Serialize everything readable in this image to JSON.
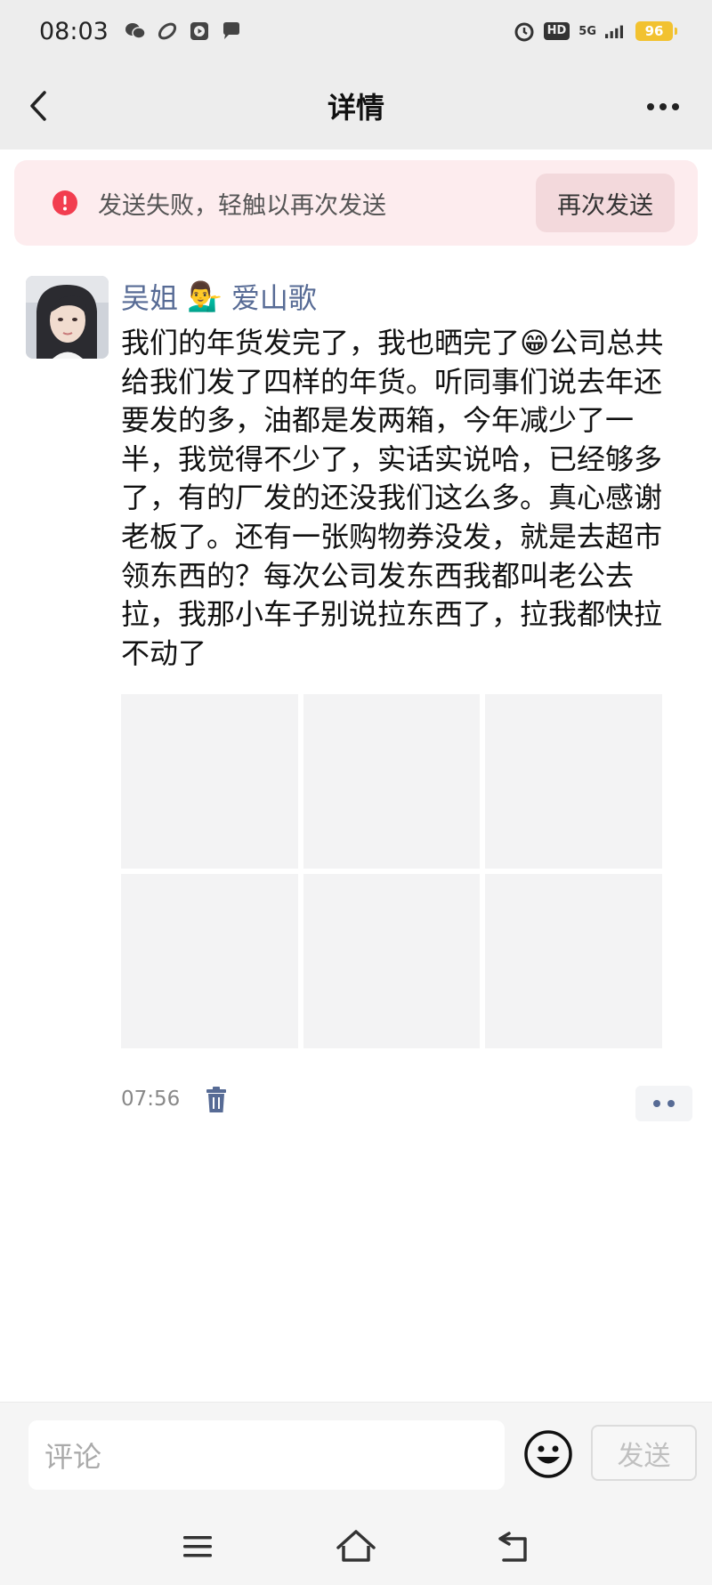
{
  "status_bar": {
    "time": "08:03",
    "left_icons": [
      "wechat-icon",
      "feather-icon",
      "play-icon",
      "chat-bubble-icon"
    ],
    "hd_label": "HD",
    "network_label": "5G",
    "battery": "96",
    "colors": {
      "battery": "#f2c230"
    }
  },
  "nav": {
    "title": "详情",
    "back_icon": "chevron-left-icon",
    "more_icon": "more-horizontal-icon"
  },
  "error_banner": {
    "message": "发送失败，轻触以再次发送",
    "button_label": "再次发送",
    "icon": "alert-circle-icon",
    "colors": {
      "background": "#fdecee",
      "icon": "#f23d4f"
    }
  },
  "post": {
    "author": "吴姐",
    "author_emoji": "💁‍♂️",
    "author_suffix": "爱山歌",
    "text": "我们的年货发完了，我也晒完了😁公司总共给我们发了四样的年货。听同事们说去年还要发的多，油都是发两箱，今年减少了一半，我觉得不少了，实话实说哈，已经够多了，有的厂发的还没我们这么多。真心感谢老板了。还有一张购物券没发，就是去超市领东西的？每次公司发东西我都叫老公去拉，我那小车子别说拉东西了，拉我都快拉不动了",
    "image_count": 6,
    "time": "07:56",
    "colors": {
      "author": "#576b95"
    }
  },
  "comment_bar": {
    "placeholder": "评论",
    "send_label": "发送"
  }
}
